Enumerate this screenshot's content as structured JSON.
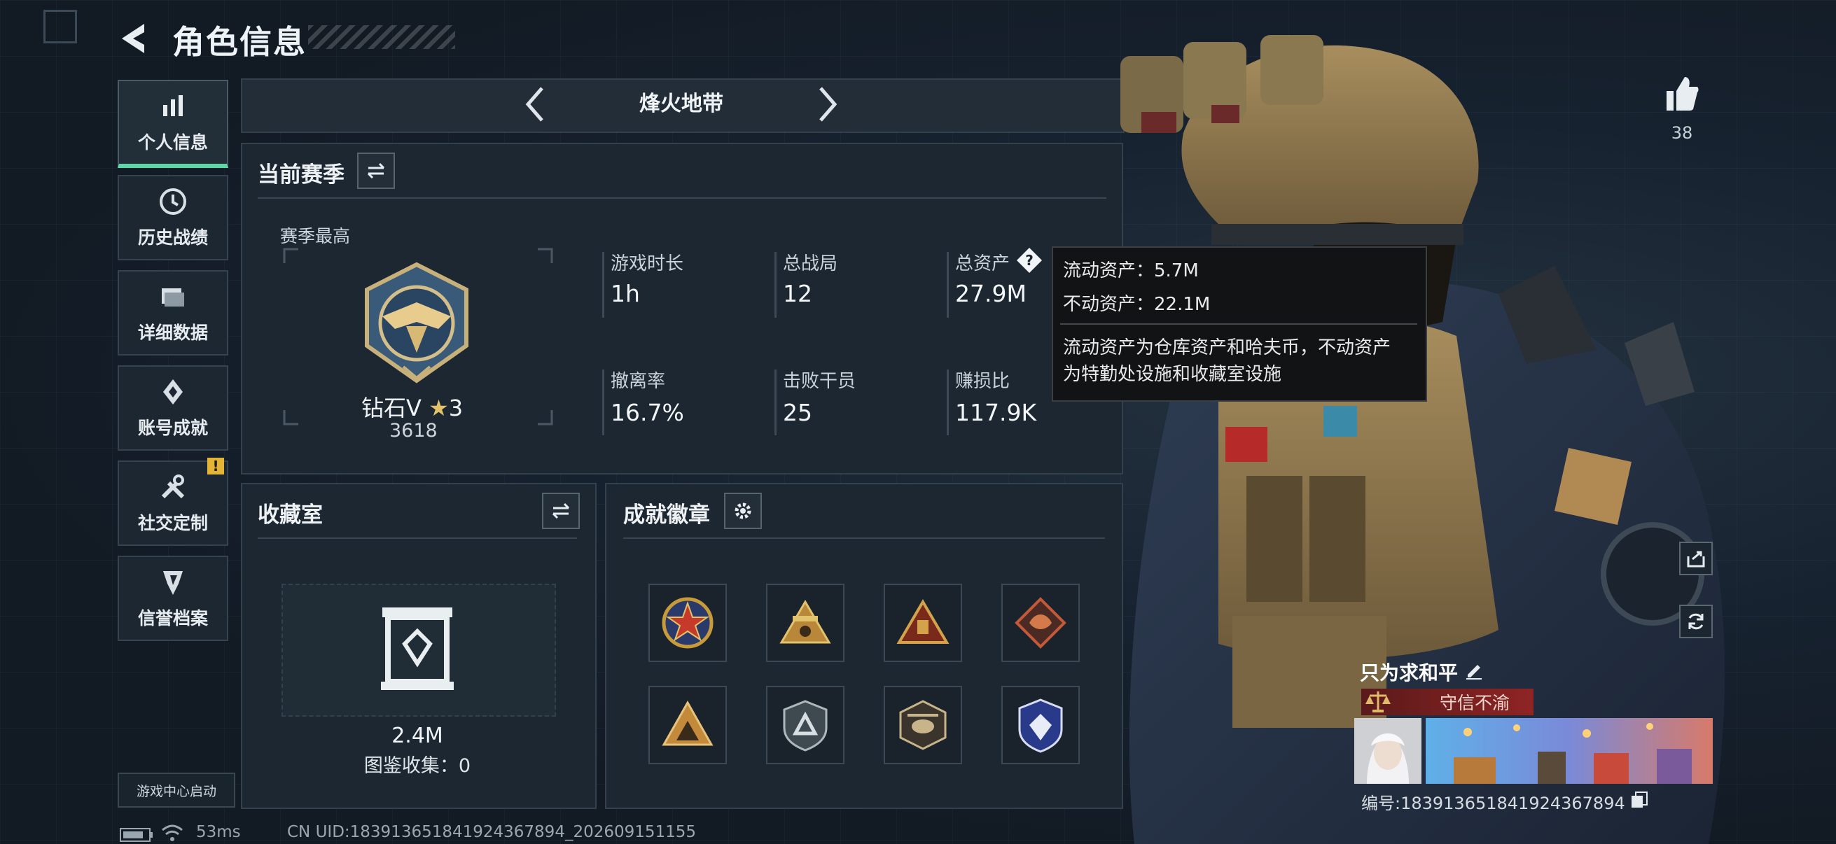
{
  "header": {
    "title": "角色信息"
  },
  "nav": {
    "items": [
      {
        "label": "个人信息",
        "icon": "bar-chart-icon"
      },
      {
        "label": "历史战绩",
        "icon": "clock-icon"
      },
      {
        "label": "详细数据",
        "icon": "folder-icon"
      },
      {
        "label": "账号成就",
        "icon": "achievement-icon"
      },
      {
        "label": "社交定制",
        "icon": "wrench-icon"
      },
      {
        "label": "信誉档案",
        "icon": "shield-icon"
      }
    ],
    "warn_badge": "!",
    "game_center": "游戏中心启动"
  },
  "mode": {
    "name": "烽火地带"
  },
  "season": {
    "title": "当前赛季",
    "best_label": "赛季最高",
    "rank": "钻石V",
    "rank_stars": "3",
    "rank_score": "3618",
    "stats": [
      {
        "label": "游戏时长",
        "value": "1h"
      },
      {
        "label": "总战局",
        "value": "12"
      },
      {
        "label": "总资产",
        "value": "27.9M"
      },
      {
        "label": "撤离率",
        "value": "16.7%"
      },
      {
        "label": "击败干员",
        "value": "25"
      },
      {
        "label": "赚损比",
        "value": "117.9K"
      }
    ]
  },
  "tooltip": {
    "liquid": "流动资产：5.7M",
    "fixed": "不动资产：22.1M",
    "desc1": "流动资产为仓库资产和哈夫币，不动资产",
    "desc2": "为特勤处设施和收藏室设施"
  },
  "collection": {
    "title": "收藏室",
    "value": "2.4M",
    "catalog": "图鉴收集：0"
  },
  "achievements": {
    "title": "成就徽章"
  },
  "profile": {
    "likes": "38",
    "name": "只为求和平",
    "title_badge": "守信不渝",
    "uid": "编号:1839136518419243678​94"
  },
  "footer": {
    "ping": "53ms",
    "uid": "CN UID:18391365184192436789​4_202609151155"
  },
  "colors": {
    "accent": "#5fd6a8",
    "warning": "#e4b437",
    "title_badge": "#8f2424"
  }
}
